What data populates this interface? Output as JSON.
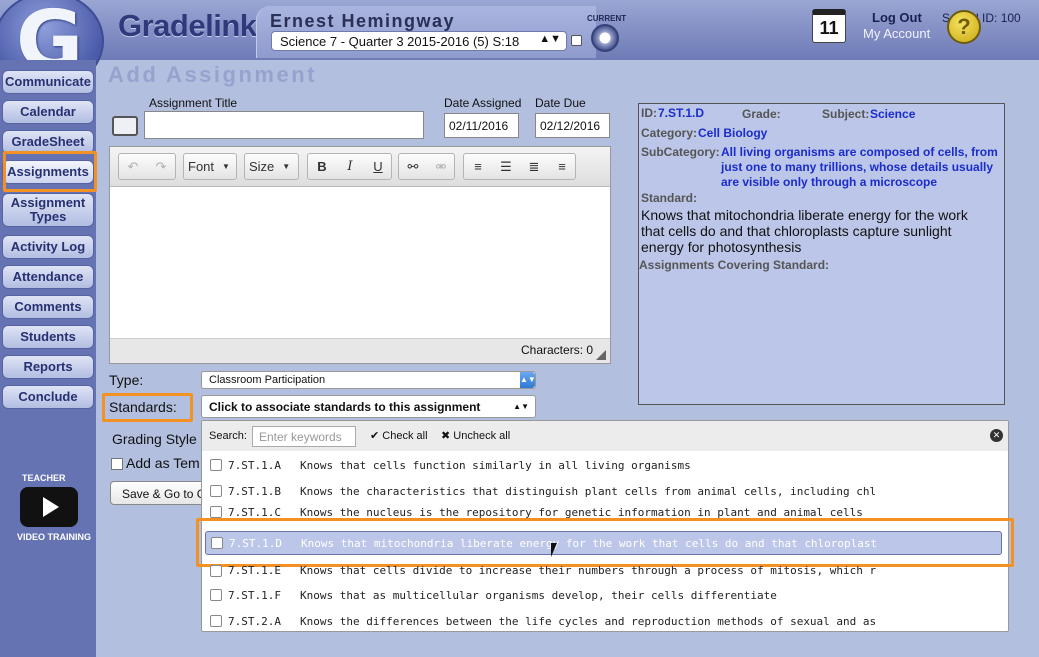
{
  "header": {
    "brand": "Gradelink",
    "logo_letter": "G",
    "teacher_name": "Ernest Hemingway",
    "class_select": "Science 7 - Quarter 3 2015-2016 (5) S:18",
    "current_label": "CURRENT",
    "calendar_day": "11",
    "logout": "Log Out",
    "my_account": "My Account",
    "school_id": "School ID: 100",
    "help": "?"
  },
  "sidebar": {
    "items": [
      {
        "label": "Communicate"
      },
      {
        "label": "Calendar"
      },
      {
        "label": "GradeSheet"
      },
      {
        "label": "Assignments"
      },
      {
        "label": "Assignment Types"
      },
      {
        "label": "Activity Log"
      },
      {
        "label": "Attendance"
      },
      {
        "label": "Comments"
      },
      {
        "label": "Students"
      },
      {
        "label": "Reports"
      },
      {
        "label": "Conclude"
      }
    ],
    "video_top": "TEACHER",
    "video_bottom": "VIDEO TRAINING"
  },
  "form": {
    "page_title": "Add Assignment",
    "title_label": "Assignment Title",
    "title_value": "",
    "date_assigned_label": "Date Assigned",
    "date_assigned": "02/11/2016",
    "date_due_label": "Date Due",
    "date_due": "02/12/2016",
    "toolbar": {
      "undo": "↶",
      "redo": "↷",
      "font": "Font",
      "size": "Size",
      "bold": "B",
      "italic": "I",
      "underline": "U"
    },
    "characters": "Characters: 0",
    "type_label": "Type:",
    "type_value": "Classroom Participation",
    "standards_label": "Standards:",
    "standards_value": "Click to associate standards to this assignment",
    "grading_style": "Grading Style",
    "add_as_template": "Add as Tem",
    "save_button": "Save & Go to G"
  },
  "standard_detail": {
    "id_label": "ID:",
    "id_value": "7.ST.1.D",
    "grade_label": "Grade:",
    "subject_label": "Subject:",
    "subject_value": "Science",
    "category_label": "Category:",
    "category_value": "Cell Biology",
    "subcategory_label": "SubCategory:",
    "subcategory_value": "All living organisms are composed of cells, from just one to many trillions, whose details usually are visible only through a microscope",
    "standard_label": "Standard:",
    "standard_value": "Knows that mitochondria liberate energy for the work that cells do and that chloroplasts capture sunlight energy for photosynthesis",
    "covering_label": "Assignments Covering Standard:"
  },
  "standards_list": {
    "search_label": "Search:",
    "search_placeholder": "Enter keywords",
    "check_all": "Check all",
    "uncheck_all": "Uncheck all",
    "rows": [
      {
        "code": "7.ST.1.A",
        "text": "Knows that cells function similarly in all living organisms"
      },
      {
        "code": "7.ST.1.B",
        "text": "Knows the characteristics that distinguish plant cells from animal cells, including chl"
      },
      {
        "code": "7.ST.1.C",
        "text": "Knows the nucleus is the repository for genetic information in plant and animal cells"
      },
      {
        "code": "7.ST.1.D",
        "text": "Knows that mitochondria liberate energy for the work that cells do and that chloroplast"
      },
      {
        "code": "7.ST.1.E",
        "text": "Knows that cells divide to increase their numbers through a process of mitosis, which r"
      },
      {
        "code": "7.ST.1.F",
        "text": "Knows that as multicellular organisms develop, their cells differentiate"
      },
      {
        "code": "7.ST.2.A",
        "text": "Knows the differences between the life cycles and reproduction methods of sexual and as"
      }
    ]
  }
}
